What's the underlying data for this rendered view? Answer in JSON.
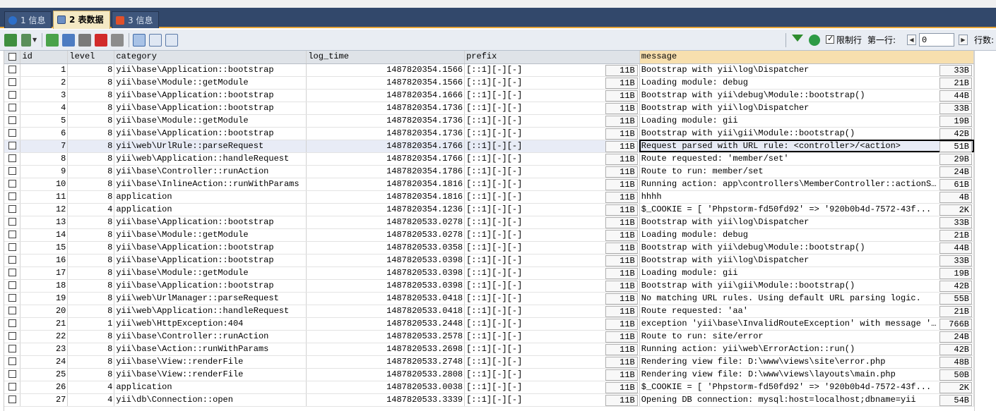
{
  "tabs": [
    {
      "label": "1 信息",
      "icon": "info-icon",
      "active": false
    },
    {
      "label": "2 表数据",
      "icon": "table-data-icon",
      "active": true
    },
    {
      "label": "3 信息",
      "icon": "object-info-icon",
      "active": false
    }
  ],
  "toolbar": {
    "limit_label": "限制行",
    "first_row_label": "第一行:",
    "first_row_value": "0",
    "rows_label": "行数:"
  },
  "columns": [
    "id",
    "level",
    "category",
    "log_time",
    "prefix",
    "message"
  ],
  "rows": [
    {
      "id": "1",
      "level": "8",
      "category": "yii\\base\\Application::bootstrap",
      "log_time": "1487820354.1566",
      "prefix": "[::1][-][-]",
      "prefix_size": "11B",
      "message": "Bootstrap with yii\\log\\Dispatcher",
      "message_size": "33B"
    },
    {
      "id": "2",
      "level": "8",
      "category": "yii\\base\\Module::getModule",
      "log_time": "1487820354.1566",
      "prefix": "[::1][-][-]",
      "prefix_size": "11B",
      "message": "Loading module: debug",
      "message_size": "21B"
    },
    {
      "id": "3",
      "level": "8",
      "category": "yii\\base\\Application::bootstrap",
      "log_time": "1487820354.1666",
      "prefix": "[::1][-][-]",
      "prefix_size": "11B",
      "message": "Bootstrap with yii\\debug\\Module::bootstrap()",
      "message_size": "44B"
    },
    {
      "id": "4",
      "level": "8",
      "category": "yii\\base\\Application::bootstrap",
      "log_time": "1487820354.1736",
      "prefix": "[::1][-][-]",
      "prefix_size": "11B",
      "message": "Bootstrap with yii\\log\\Dispatcher",
      "message_size": "33B"
    },
    {
      "id": "5",
      "level": "8",
      "category": "yii\\base\\Module::getModule",
      "log_time": "1487820354.1736",
      "prefix": "[::1][-][-]",
      "prefix_size": "11B",
      "message": "Loading module: gii",
      "message_size": "19B"
    },
    {
      "id": "6",
      "level": "8",
      "category": "yii\\base\\Application::bootstrap",
      "log_time": "1487820354.1736",
      "prefix": "[::1][-][-]",
      "prefix_size": "11B",
      "message": "Bootstrap with yii\\gii\\Module::bootstrap()",
      "message_size": "42B"
    },
    {
      "id": "7",
      "level": "8",
      "category": "yii\\web\\UrlRule::parseRequest",
      "log_time": "1487820354.1766",
      "prefix": "[::1][-][-]",
      "prefix_size": "11B",
      "message": "Request parsed with URL rule: <controller>/<action>",
      "message_size": "51B",
      "selected": true
    },
    {
      "id": "8",
      "level": "8",
      "category": "yii\\web\\Application::handleRequest",
      "log_time": "1487820354.1766",
      "prefix": "[::1][-][-]",
      "prefix_size": "11B",
      "message": "Route requested: 'member/set'",
      "message_size": "29B"
    },
    {
      "id": "9",
      "level": "8",
      "category": "yii\\base\\Controller::runAction",
      "log_time": "1487820354.1786",
      "prefix": "[::1][-][-]",
      "prefix_size": "11B",
      "message": "Route to run: member/set",
      "message_size": "24B"
    },
    {
      "id": "10",
      "level": "8",
      "category": "yii\\base\\InlineAction::runWithParams",
      "log_time": "1487820354.1816",
      "prefix": "[::1][-][-]",
      "prefix_size": "11B",
      "message": "Running action: app\\controllers\\MemberController::actionS...",
      "message_size": "61B"
    },
    {
      "id": "11",
      "level": "8",
      "category": "application",
      "log_time": "1487820354.1816",
      "prefix": "[::1][-][-]",
      "prefix_size": "11B",
      "message": "hhhh",
      "message_size": "4B"
    },
    {
      "id": "12",
      "level": "4",
      "category": "application",
      "log_time": "1487820354.1236",
      "prefix": "[::1][-][-]",
      "prefix_size": "11B",
      "message": "$_COOKIE = [    'Phpstorm-fd50fd92' => '920b0b4d-7572-43f...",
      "message_size": "2K"
    },
    {
      "id": "13",
      "level": "8",
      "category": "yii\\base\\Application::bootstrap",
      "log_time": "1487820533.0278",
      "prefix": "[::1][-][-]",
      "prefix_size": "11B",
      "message": "Bootstrap with yii\\log\\Dispatcher",
      "message_size": "33B"
    },
    {
      "id": "14",
      "level": "8",
      "category": "yii\\base\\Module::getModule",
      "log_time": "1487820533.0278",
      "prefix": "[::1][-][-]",
      "prefix_size": "11B",
      "message": "Loading module: debug",
      "message_size": "21B"
    },
    {
      "id": "15",
      "level": "8",
      "category": "yii\\base\\Application::bootstrap",
      "log_time": "1487820533.0358",
      "prefix": "[::1][-][-]",
      "prefix_size": "11B",
      "message": "Bootstrap with yii\\debug\\Module::bootstrap()",
      "message_size": "44B"
    },
    {
      "id": "16",
      "level": "8",
      "category": "yii\\base\\Application::bootstrap",
      "log_time": "1487820533.0398",
      "prefix": "[::1][-][-]",
      "prefix_size": "11B",
      "message": "Bootstrap with yii\\log\\Dispatcher",
      "message_size": "33B"
    },
    {
      "id": "17",
      "level": "8",
      "category": "yii\\base\\Module::getModule",
      "log_time": "1487820533.0398",
      "prefix": "[::1][-][-]",
      "prefix_size": "11B",
      "message": "Loading module: gii",
      "message_size": "19B"
    },
    {
      "id": "18",
      "level": "8",
      "category": "yii\\base\\Application::bootstrap",
      "log_time": "1487820533.0398",
      "prefix": "[::1][-][-]",
      "prefix_size": "11B",
      "message": "Bootstrap with yii\\gii\\Module::bootstrap()",
      "message_size": "42B"
    },
    {
      "id": "19",
      "level": "8",
      "category": "yii\\web\\UrlManager::parseRequest",
      "log_time": "1487820533.0418",
      "prefix": "[::1][-][-]",
      "prefix_size": "11B",
      "message": "No matching URL rules. Using default URL parsing logic.",
      "message_size": "55B"
    },
    {
      "id": "20",
      "level": "8",
      "category": "yii\\web\\Application::handleRequest",
      "log_time": "1487820533.0418",
      "prefix": "[::1][-][-]",
      "prefix_size": "11B",
      "message": "Route requested: 'aa'",
      "message_size": "21B"
    },
    {
      "id": "21",
      "level": "1",
      "category": "yii\\web\\HttpException:404",
      "log_time": "1487820533.2448",
      "prefix": "[::1][-][-]",
      "prefix_size": "11B",
      "message": "exception 'yii\\base\\InvalidRouteException' with message '...",
      "message_size": "766B"
    },
    {
      "id": "22",
      "level": "8",
      "category": "yii\\base\\Controller::runAction",
      "log_time": "1487820533.2578",
      "prefix": "[::1][-][-]",
      "prefix_size": "11B",
      "message": "Route to run: site/error",
      "message_size": "24B"
    },
    {
      "id": "23",
      "level": "8",
      "category": "yii\\base\\Action::runWithParams",
      "log_time": "1487820533.2698",
      "prefix": "[::1][-][-]",
      "prefix_size": "11B",
      "message": "Running action: yii\\web\\ErrorAction::run()",
      "message_size": "42B"
    },
    {
      "id": "24",
      "level": "8",
      "category": "yii\\base\\View::renderFile",
      "log_time": "1487820533.2748",
      "prefix": "[::1][-][-]",
      "prefix_size": "11B",
      "message": "Rendering view file: D:\\www\\views\\site\\error.php",
      "message_size": "48B"
    },
    {
      "id": "25",
      "level": "8",
      "category": "yii\\base\\View::renderFile",
      "log_time": "1487820533.2808",
      "prefix": "[::1][-][-]",
      "prefix_size": "11B",
      "message": "Rendering view file: D:\\www\\views\\layouts\\main.php",
      "message_size": "50B"
    },
    {
      "id": "26",
      "level": "4",
      "category": "application",
      "log_time": "1487820533.0038",
      "prefix": "[::1][-][-]",
      "prefix_size": "11B",
      "message": "$_COOKIE = [    'Phpstorm-fd50fd92' => '920b0b4d-7572-43f...",
      "message_size": "2K"
    },
    {
      "id": "27",
      "level": "4",
      "category": "yii\\db\\Connection::open",
      "log_time": "1487820533.3339",
      "prefix": "[::1][-][-]",
      "prefix_size": "11B",
      "message": "Opening DB connection: mysql:host=localhost;dbname=yii",
      "message_size": "54B"
    }
  ]
}
